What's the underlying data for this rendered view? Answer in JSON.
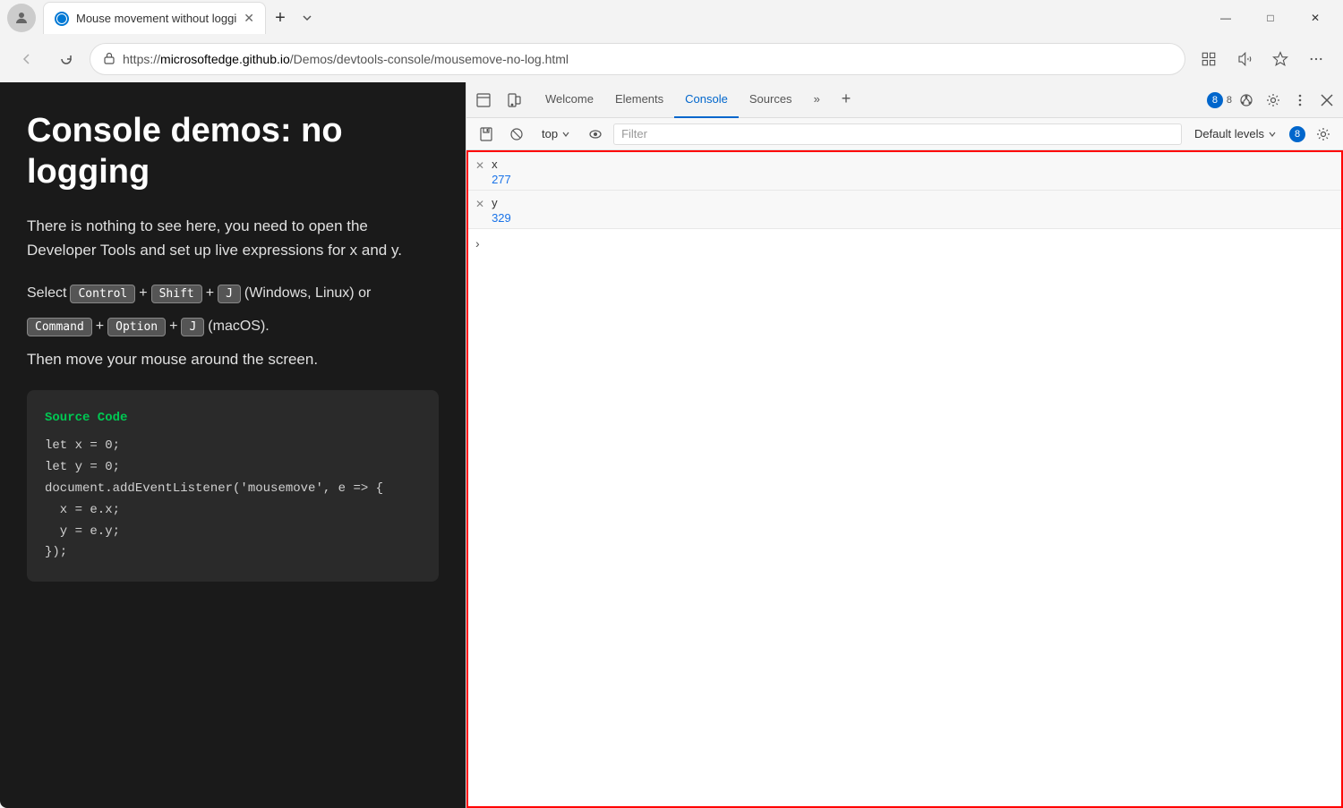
{
  "browser": {
    "tab_title": "Mouse movement without loggi",
    "url_protocol": "https://",
    "url_host": "microsoftedge.github.io",
    "url_path": "/Demos/devtools-console/mousemove-no-log.html"
  },
  "webpage": {
    "title": "Console demos: no logging",
    "description": "There is nothing to see here, you need to open the Developer Tools and set up live expressions for x and y.",
    "shortcut_line1_prefix": "Select",
    "shortcut_control": "Control",
    "shortcut_shift": "Shift",
    "shortcut_j": "J",
    "shortcut_windows_suffix": "(Windows, Linux) or",
    "shortcut_command": "Command",
    "shortcut_option": "Option",
    "shortcut_j2": "J",
    "shortcut_mac_suffix": "(macOS).",
    "then_text": "Then move your mouse around the screen.",
    "code_label": "Source Code",
    "code_lines": [
      "let x = 0;",
      "let y = 0;",
      "document.addEventListener('mousemove', e => {",
      "  x = e.x;",
      "  y = e.y;",
      "});"
    ]
  },
  "devtools": {
    "tabs": [
      "Welcome",
      "Elements",
      "Console",
      "Sources"
    ],
    "active_tab": "Console",
    "more_icon": "»",
    "add_icon": "+",
    "badge_count": "8",
    "toolbar": {
      "context": "top",
      "filter_placeholder": "Filter",
      "levels_label": "Default levels",
      "levels_count": "8"
    },
    "console_entries": [
      {
        "name": "x",
        "value": "277"
      },
      {
        "name": "y",
        "value": "329"
      }
    ]
  },
  "icons": {
    "back": "←",
    "refresh": "↻",
    "lock": "🔒",
    "profile": "👤",
    "reading": "📖",
    "favorites": "☆",
    "more_browser": "…",
    "devtools_inspect": "⬜",
    "devtools_device": "⬛",
    "clear": "🚫",
    "eye": "👁",
    "settings_gear": "⚙",
    "more_devtools": "⋮",
    "close_devtools": "✕",
    "close_entry": "✕",
    "chevron_down": "▾",
    "chevron_right": "›",
    "save": "💾",
    "win_minimize": "—",
    "win_maximize": "□",
    "win_close": "✕"
  }
}
